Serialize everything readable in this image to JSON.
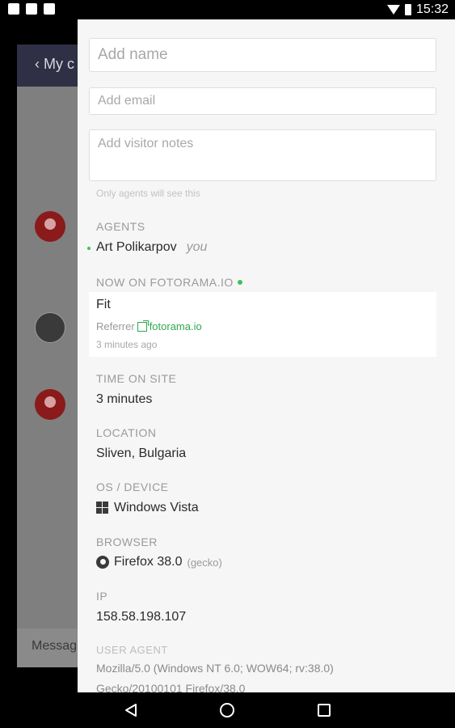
{
  "status_bar": {
    "time": "15:32"
  },
  "background": {
    "back_label": "My c",
    "message_placeholder": "Messag"
  },
  "form": {
    "name_placeholder": "Add name",
    "email_placeholder": "Add email",
    "notes_placeholder": "Add visitor notes",
    "notes_hint": "Only agents will see this"
  },
  "agents": {
    "label": "AGENTS",
    "name": "Art Polikarpov",
    "you_label": "you"
  },
  "now_on": {
    "label": "NOW ON FOTORAMA.IO",
    "page_title": "Fit",
    "referrer_label": "Referrer",
    "referrer_link": "fotorama.io",
    "time_ago": "3 minutes ago"
  },
  "time_on_site": {
    "label": "TIME ON SITE",
    "value": "3 minutes"
  },
  "location": {
    "label": "LOCATION",
    "value": "Sliven, Bulgaria"
  },
  "os_device": {
    "label": "OS / DEVICE",
    "value": "Windows Vista",
    "icon": "windows-icon"
  },
  "browser": {
    "label": "BROWSER",
    "value": "Firefox 38.0",
    "engine": "(gecko)",
    "icon": "firefox-icon"
  },
  "ip": {
    "label": "IP",
    "value": "158.58.198.107"
  },
  "user_agent": {
    "label": "USER AGENT",
    "line1": "Mozilla/5.0 (Windows NT 6.0; WOW64; rv:38.0)",
    "line2": "Gecko/20100101 Firefox/38.0"
  },
  "colors": {
    "online_green": "#3cc25a",
    "link_green": "#2fa84f",
    "header_dark": "#2f2f45",
    "avatar_red": "#8b1a1a"
  }
}
